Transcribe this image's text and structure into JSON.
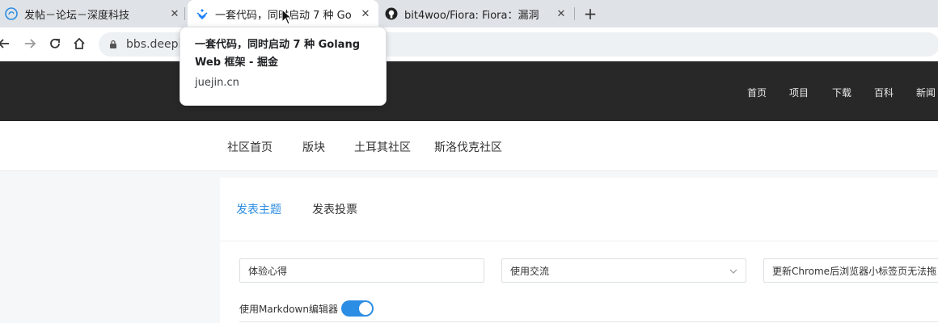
{
  "browser": {
    "tabs": [
      {
        "title": "发帖－论坛－深度科技",
        "icon": "deepin-logo-icon",
        "close": "✕"
      },
      {
        "title": "一套代码，同时启动 7 种 Go",
        "title_faded": "",
        "icon": "juejin-logo-icon",
        "close": "✕"
      },
      {
        "title": "bit4woo/Fiora: Fiora：漏洞",
        "icon": "github-icon",
        "close": "✕"
      }
    ],
    "new_tab": "+",
    "address": "bbs.deepi"
  },
  "tooltip": {
    "title": "一套代码，同时启动 7 种 Golang Web 框架 - 掘金",
    "domain": "juejin.cn"
  },
  "site": {
    "top_nav": [
      "首页",
      "项目",
      "下载",
      "百科",
      "新闻"
    ],
    "sub_nav": [
      "社区首页",
      "版块",
      "土耳其社区",
      "斯洛伐克社区"
    ]
  },
  "compose": {
    "tabs": [
      "发表主题",
      "发表投票"
    ],
    "title_value": "体验心得",
    "category_value": "使用交流",
    "tags_value": "更新Chrome后浏览器小标签页无法拖",
    "markdown_label": "使用Markdown编辑器",
    "markdown_enabled": true
  },
  "colors": {
    "accent": "#2b8de3",
    "header_bg": "#282828"
  }
}
